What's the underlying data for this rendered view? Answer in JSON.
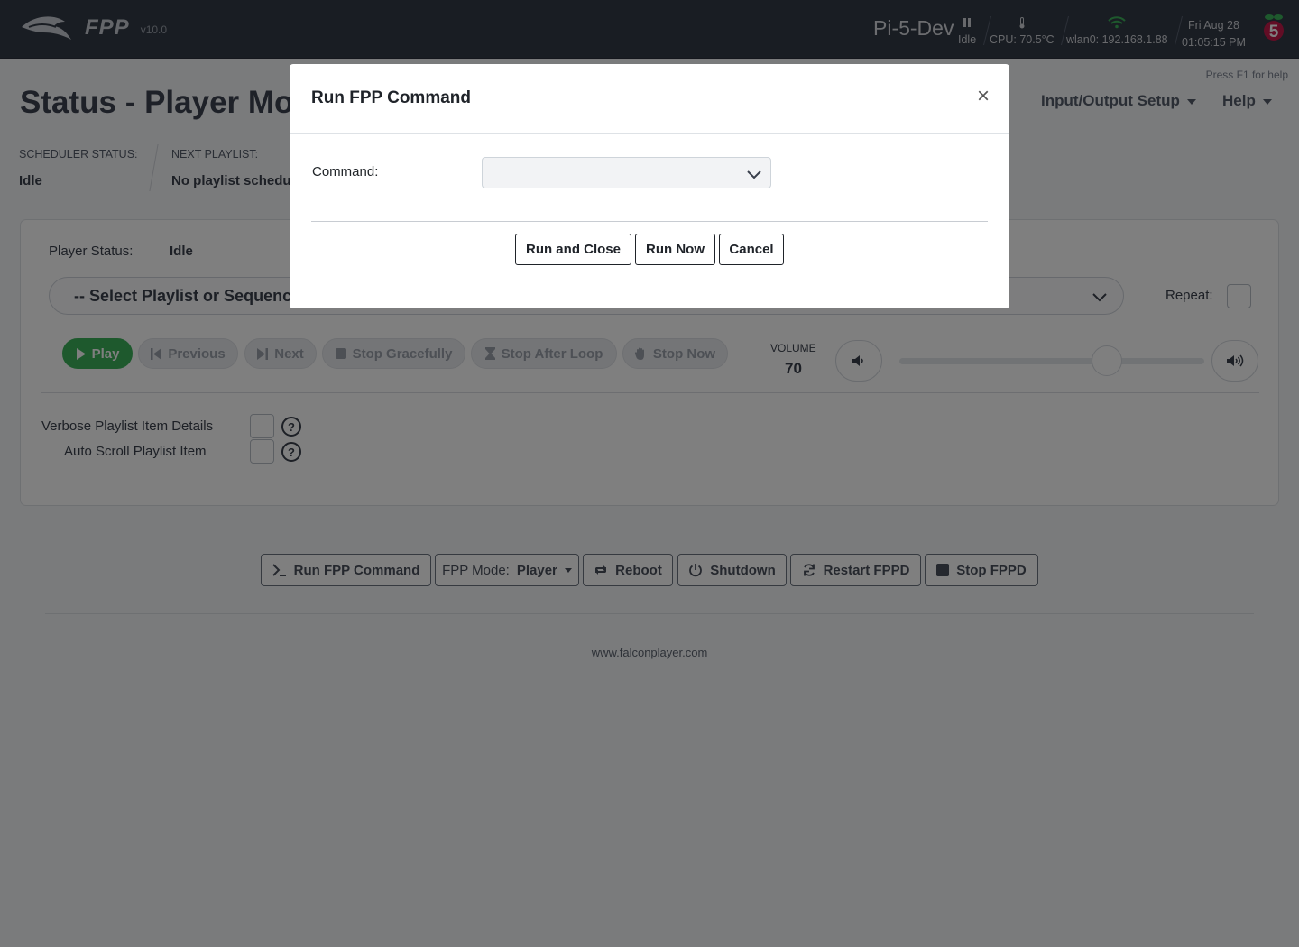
{
  "header": {
    "logo_text": "FPP",
    "version": "v10.0",
    "hostname": "Pi-5-Dev",
    "player_state": "Idle",
    "cpu_temp": "CPU: 70.5°C",
    "network": "wlan0: 192.168.1.88",
    "date": "Fri Aug 28",
    "time": "01:05:15 PM",
    "pi_model_badge": "5"
  },
  "page": {
    "help_hint": "Press F1 for help",
    "title": "Status - Player Mode",
    "nav": [
      {
        "label": "Input/Output Setup"
      },
      {
        "label": "Help"
      }
    ],
    "scheduler_status_label": "Scheduler Status:",
    "scheduler_status_value": "Idle",
    "next_playlist_label": "Next Playlist:",
    "next_playlist_value": "No playlist scheduled."
  },
  "player": {
    "status_label": "Player Status:",
    "status_value": "Idle",
    "playlist_placeholder": "-- Select Playlist or Sequence --",
    "repeat_label": "Repeat:",
    "controls": {
      "play": "Play",
      "previous": "Previous",
      "next": "Next",
      "stop_gracefully": "Stop Gracefully",
      "stop_after_loop": "Stop After Loop",
      "stop_now": "Stop Now"
    },
    "volume_label": "VOLUME",
    "volume_value": "70",
    "volume_level": 0.68,
    "verbose_label": "Verbose Playlist Item Details",
    "autoscroll_label": "Auto Scroll Playlist Item"
  },
  "footer": {
    "run_command": "Run FPP Command",
    "mode_prefix": "FPP Mode:",
    "mode_value": "Player",
    "reboot": "Reboot",
    "shutdown": "Shutdown",
    "restart": "Restart FPPD",
    "stop": "Stop FPPD",
    "link": "www.falconplayer.com"
  },
  "modal": {
    "title": "Run FPP Command",
    "close": "×",
    "command_label": "Command:",
    "command_value": "",
    "run_and_close": "Run and Close",
    "run_now": "Run Now",
    "cancel": "Cancel"
  },
  "colors": {
    "header_bg": "#333a47",
    "play_green": "#3cb35b",
    "overlay": "rgba(0,0,0,0.5)"
  }
}
